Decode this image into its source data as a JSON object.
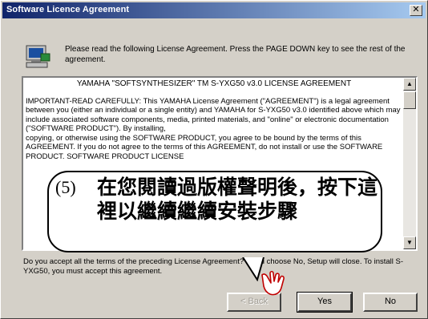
{
  "window": {
    "title": "Software Licence Agreement",
    "close_label": "✕"
  },
  "intro": {
    "text": "Please read the following License Agreement. Press the PAGE DOWN key to see the rest of the agreement."
  },
  "license": {
    "heading": "YAMAHA \"SOFTSYNTHESIZER\" TM S-YXG50 v3.0 LICENSE AGREEMENT",
    "p1": "IMPORTANT-READ CAREFULLY: This YAMAHA License Agreement (\"AGREEMENT\") is a legal agreement",
    "p2": "between you (either an individual or a single entity) and YAMAHA for S-YXG50 v3.0 identified above which may include associated software components, media, printed materials, and \"online\" or electronic documentation (\"SOFTWARE PRODUCT\"). By installing,",
    "p3": "copying, or otherwise using the SOFTWARE PRODUCT, you agree to be bound by the terms of this AGREEMENT. If you do not agree to the terms of this AGREEMENT, do not install or use the SOFTWARE PRODUCT. SOFTWARE PRODUCT LICENSE"
  },
  "scrollbar": {
    "up_label": "▲",
    "down_label": "▼"
  },
  "question": {
    "text": "Do you accept all the terms of the preceding License Agreement? If you choose No, Setup will close. To install S-YXG50, you must accept this agreement."
  },
  "buttons": {
    "back_label": "< Back",
    "yes_label": "Yes",
    "no_label": "No"
  },
  "callout": {
    "number": "(5)",
    "text": "在您閱讀過版權聲明後，按下這裡以繼續繼續安裝步驟"
  },
  "icons": {
    "app": "setup-computer-icon",
    "hand": "pointing-hand-icon"
  },
  "colors": {
    "titlebar_start": "#10246a",
    "titlebar_end": "#a6caf0",
    "window_face": "#d4d0c8"
  }
}
